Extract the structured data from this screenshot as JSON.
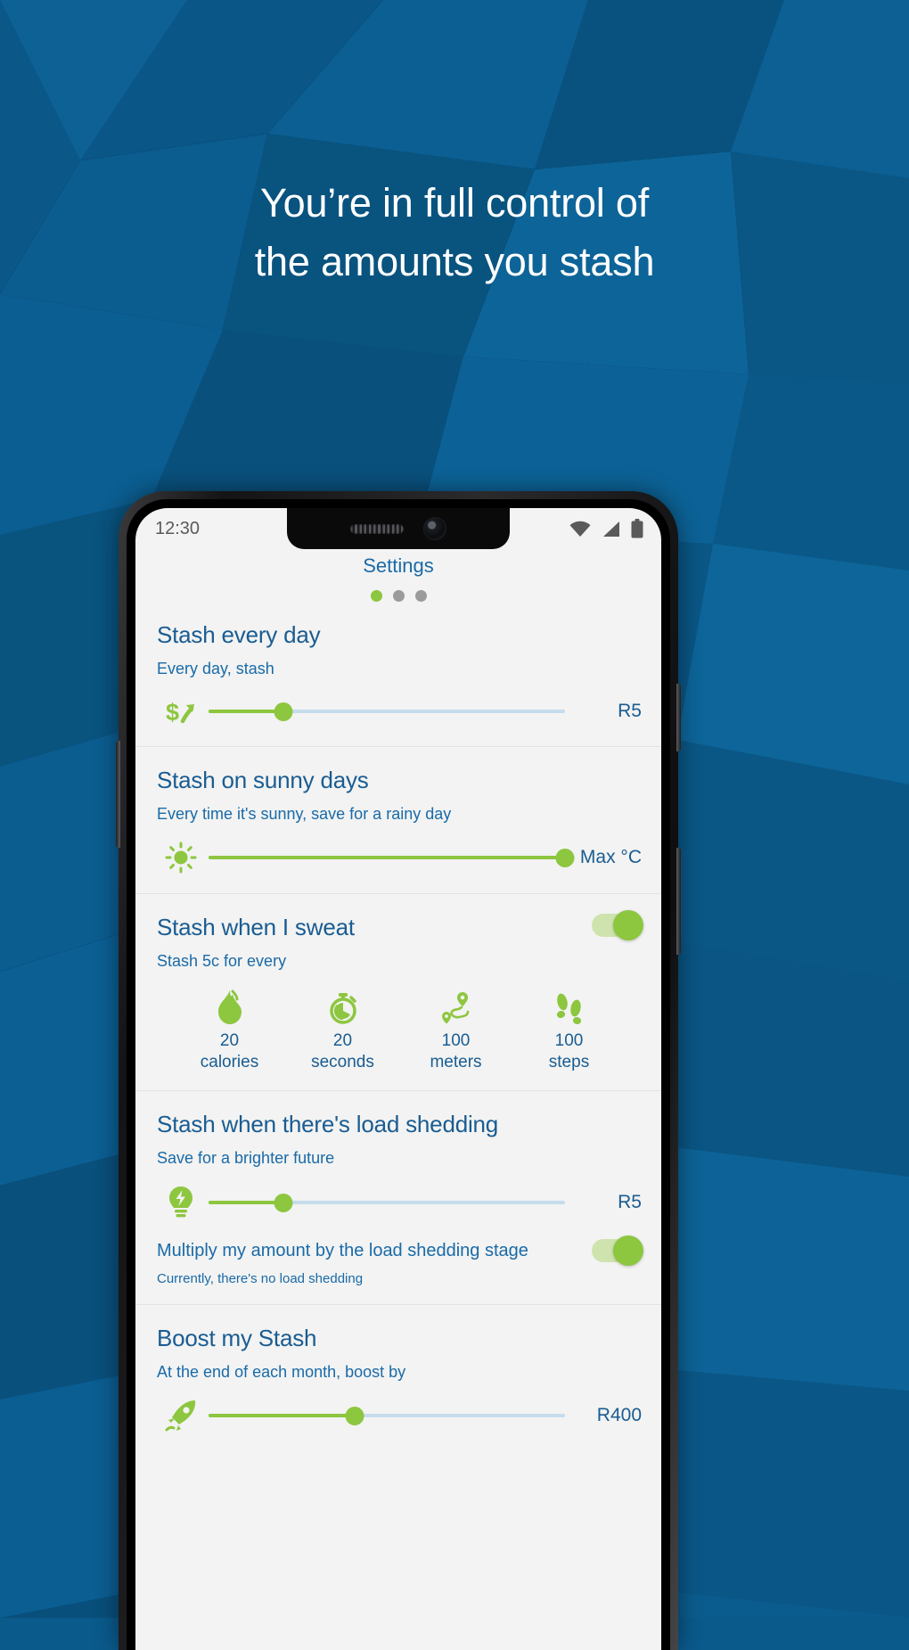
{
  "background": {
    "base_color": "#0a5a8c",
    "style": "low-poly-triangles"
  },
  "headline": {
    "line1": "You’re in full control of",
    "line2": "the amounts you stash"
  },
  "phone": {
    "status_bar": {
      "time": "12:30",
      "icons": [
        "wifi-icon",
        "cellular-signal-icon",
        "battery-icon"
      ]
    },
    "app": {
      "title": "Settings",
      "pager_dots": {
        "count": 3,
        "active_index": 0,
        "active_color": "#8dc63f",
        "inactive_color": "#9b9b9b"
      },
      "accent_green": "#8dc63f",
      "accent_blue": "#1a5c92",
      "sections": [
        {
          "id": "stash-every-day",
          "title": "Stash every day",
          "subtitle": "Every day, stash",
          "icon": "money-up-icon",
          "slider": {
            "percent": 21,
            "value_label": "R5"
          },
          "toggle": null
        },
        {
          "id": "stash-on-sunny-days",
          "title": "Stash on sunny days",
          "subtitle": "Every time it's sunny, save for a rainy day",
          "icon": "sun-icon",
          "slider": {
            "percent": 100,
            "value_label": "Max °C"
          },
          "toggle": null
        },
        {
          "id": "stash-when-i-sweat",
          "title": "Stash when I sweat",
          "subtitle": "Stash 5c for every",
          "toggle": {
            "state": "on"
          },
          "metrics": [
            {
              "icon": "flame-icon",
              "value": "20",
              "label": "calories"
            },
            {
              "icon": "stopwatch-icon",
              "value": "20",
              "label": "seconds"
            },
            {
              "icon": "route-pin-icon",
              "value": "100",
              "label": "meters"
            },
            {
              "icon": "footsteps-icon",
              "value": "100",
              "label": "steps"
            }
          ]
        },
        {
          "id": "stash-load-shedding",
          "title": "Stash when there's load shedding",
          "subtitle": "Save for a brighter future",
          "icon": "lightbulb-bolt-icon",
          "slider": {
            "percent": 21,
            "value_label": "R5"
          },
          "multiplier_row": {
            "label": "Multiply my amount by the load shedding stage",
            "toggle": {
              "state": "on"
            }
          },
          "note": "Currently, there's no load shedding"
        },
        {
          "id": "boost-my-stash",
          "title": "Boost my Stash",
          "subtitle": "At the end of each month, boost by",
          "icon": "rocket-icon",
          "slider": {
            "percent": 41,
            "value_label": "R400"
          }
        }
      ]
    }
  }
}
